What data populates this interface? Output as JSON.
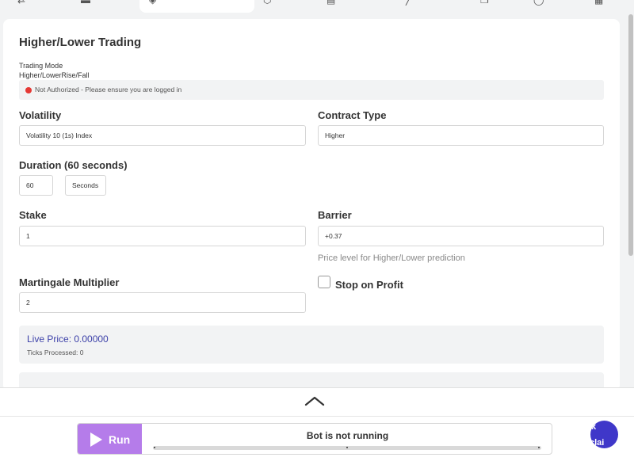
{
  "nav": {
    "icons": [
      "swap-icon",
      "menu-icon",
      "bot-builder-icon",
      "shield-icon",
      "list-icon",
      "chart-icon",
      "copy-icon",
      "circle-icon",
      "grid-icon"
    ]
  },
  "form": {
    "title": "Higher/Lower Trading",
    "trading_mode_label": "Trading Mode",
    "trading_mode_value": "Higher/LowerRise/Fall",
    "auth_status": "Not Authorized - Please ensure you are logged in",
    "volatility_label": "Volatility",
    "volatility_value": "Volatility 10 (1s) Index",
    "contract_type_label": "Contract Type",
    "contract_type_value": "Higher",
    "duration_label": "Duration (60 seconds)",
    "duration_value": "60",
    "duration_unit": "Seconds",
    "stake_label": "Stake",
    "stake_value": "1",
    "barrier_label": "Barrier",
    "barrier_value": "+0.37",
    "barrier_hint": "Price level for Higher/Lower prediction",
    "martingale_label": "Martingale Multiplier",
    "martingale_value": "2",
    "stop_on_profit_label": "Stop on Profit",
    "stop_on_profit_checked": false,
    "live_price": "Live Price: 0.00000",
    "ticks_processed": "Ticks Processed: 0"
  },
  "runbar": {
    "run_label": "Run",
    "status": "Bot is not running"
  },
  "help": {
    "text_line1": "k",
    "text_line2": "clai"
  },
  "colors": {
    "accent": "#b57cea",
    "live_price": "#3b3fa8",
    "error_dot": "#e53935",
    "help_bubble": "#3f37c9"
  }
}
